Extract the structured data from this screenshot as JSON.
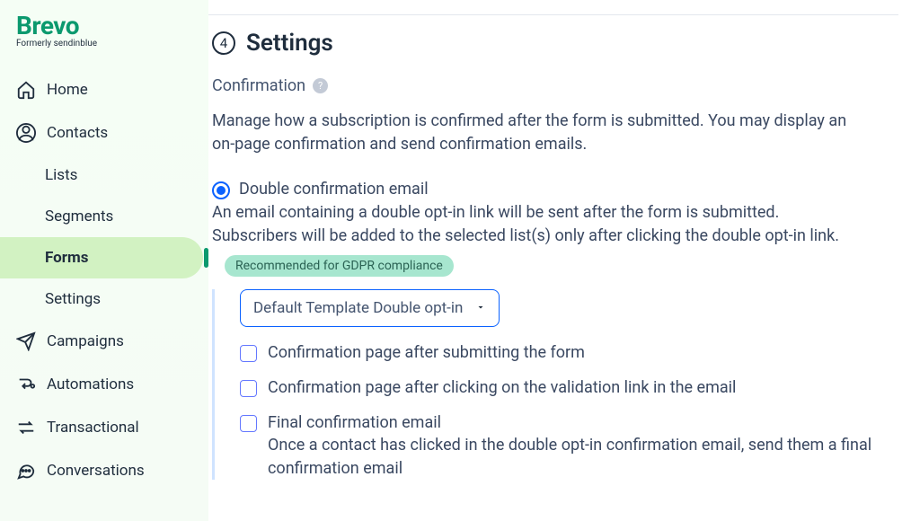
{
  "brand": {
    "name": "Brevo",
    "tagline": "Formerly sendinblue"
  },
  "sidebar": {
    "items": [
      {
        "label": "Home"
      },
      {
        "label": "Contacts"
      },
      {
        "label": "Campaigns"
      },
      {
        "label": "Automations"
      },
      {
        "label": "Transactional"
      },
      {
        "label": "Conversations"
      }
    ],
    "contacts_sub": [
      {
        "label": "Lists"
      },
      {
        "label": "Segments"
      },
      {
        "label": "Forms"
      },
      {
        "label": "Settings"
      }
    ]
  },
  "step": {
    "number": "4",
    "title": "Settings"
  },
  "section": {
    "label": "Confirmation",
    "desc": "Manage how a subscription is confirmed after the form is submitted. You may display an on-page confirmation and send confirmation emails."
  },
  "radio": {
    "label": "Double confirmation email",
    "desc": " An email containing a double opt-in link will be sent after the form is submitted. Subscribers will be added to the selected list(s) only after clicking the double opt-in link.",
    "badge": "Recommended for GDPR compliance"
  },
  "select": {
    "value": "Default Template Double opt-in"
  },
  "checks": [
    {
      "label": "Confirmation page after submitting the form",
      "desc": ""
    },
    {
      "label": "Confirmation page after clicking on the validation link in the email",
      "desc": ""
    },
    {
      "label": "Final confirmation email",
      "desc": " Once a contact has clicked in the double opt-in confirmation email, send them a final confirmation email"
    }
  ]
}
